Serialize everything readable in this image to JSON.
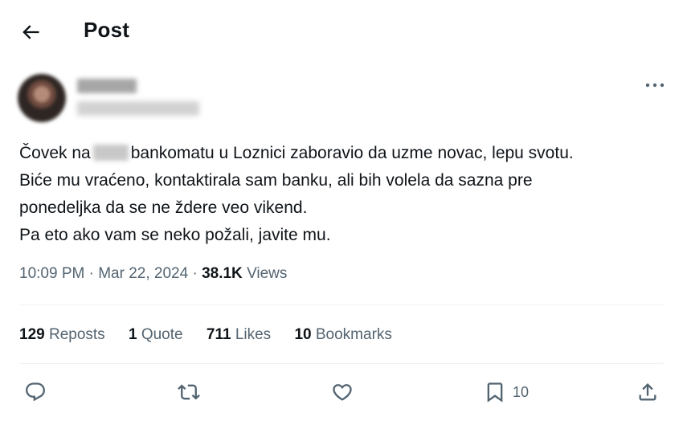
{
  "header": {
    "title": "Post"
  },
  "tweet": {
    "lines": [
      [
        "Čovek na",
        "bankomatu u Loznici zaboravio da uzme novac, lepu svotu."
      ],
      "Biće mu vraćeno, kontaktirala sam banku, ali bih volela da sazna pre",
      "ponedeljka da se ne ždere veo vikend.",
      "Pa eto ako vam se neko požali, javite mu."
    ],
    "time": "10:09 PM",
    "date": "Mar 22, 2024",
    "views_count": "38.1K",
    "views_label": "Views"
  },
  "stats": {
    "reposts": {
      "count": "129",
      "label": "Reposts"
    },
    "quotes": {
      "count": "1",
      "label": "Quote"
    },
    "likes": {
      "count": "711",
      "label": "Likes"
    },
    "bookmarks": {
      "count": "10",
      "label": "Bookmarks"
    }
  },
  "actions": {
    "bookmark_count": "10"
  },
  "icons": {
    "back": "arrow-left-icon",
    "more": "more-horizontal-icon",
    "reply": "reply-icon",
    "repost": "repost-icon",
    "like": "heart-icon",
    "bookmark": "bookmark-icon",
    "share": "share-icon"
  },
  "colors": {
    "text": "#0f1419",
    "secondary": "#536471",
    "divider": "#eff3f4"
  }
}
